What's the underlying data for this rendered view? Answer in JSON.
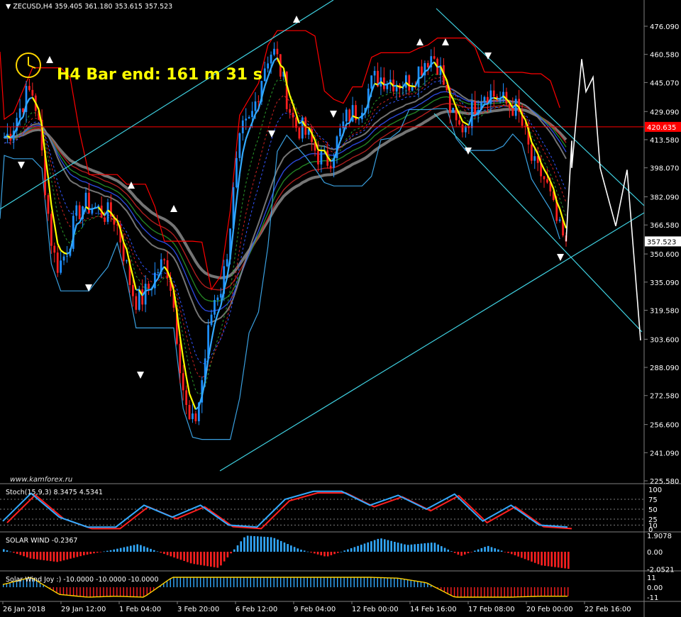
{
  "header": {
    "symbol": "ZECUSD,H4",
    "ohlc": "359.405 361.180 353.615 357.523"
  },
  "overlay": {
    "bar_end": "H4 Bar end: 161 m 31 s",
    "watermark": "www.kamforex.ru"
  },
  "colors": {
    "background": "#000000",
    "bull": "#1e90ff",
    "bear": "#ff2020",
    "channel": "#3fd0e0",
    "signal": "#ffff00",
    "resistance": "#ff0000",
    "support": "#3aa0e0",
    "level_line": "#ff0000",
    "projection": "#ffffff"
  },
  "price_axis": {
    "ticks": [
      "476.090",
      "460.580",
      "445.070",
      "429.090",
      "413.580",
      "398.070",
      "382.090",
      "366.580",
      "350.600",
      "335.090",
      "319.580",
      "303.600",
      "288.090",
      "272.580",
      "256.600",
      "241.090",
      "225.580"
    ],
    "level_label": "420.635",
    "current_label": "357.523"
  },
  "time_axis": {
    "labels": [
      "26 Jan 2018",
      "29 Jan 12:00",
      "1 Feb 04:00",
      "3 Feb 20:00",
      "6 Feb 12:00",
      "9 Feb 04:00",
      "12 Feb 00:00",
      "14 Feb 16:00",
      "17 Feb 08:00",
      "20 Feb 00:00",
      "22 Feb 16:00"
    ]
  },
  "panels": {
    "stoch": {
      "title": "Stoch(15,9,3) 8.3475 4.5341",
      "levels": [
        "100",
        "75",
        "50",
        "25",
        "10",
        "0"
      ]
    },
    "solar_wind": {
      "title": "SOLAR WIND -0.2367",
      "levels": [
        "1.9078",
        "0.00",
        "-2.0521"
      ]
    },
    "solar_joy": {
      "title": "Solar Wind Joy :) -10.0000 -10.0000 -10.0000",
      "levels": [
        "11",
        "0.00",
        "-11"
      ]
    }
  },
  "chart_data": {
    "type": "candlestick",
    "title": "ZECUSD,H4",
    "ylim": [
      225.58,
      476.09
    ],
    "level_line": 420.635,
    "last_price": 357.523,
    "anchors": [
      {
        "x": "26 Jan 2018",
        "price": 415
      },
      {
        "x": "27 Jan",
        "price": 440
      },
      {
        "x": "29 Jan 12:00",
        "price": 345
      },
      {
        "x": "31 Jan",
        "price": 378
      },
      {
        "x": "1 Feb 04:00",
        "price": 372
      },
      {
        "x": "2 Feb",
        "price": 325
      },
      {
        "x": "3 Feb 20:00",
        "price": 345
      },
      {
        "x": "5 Feb",
        "price": 256
      },
      {
        "x": "6 Feb 12:00",
        "price": 330
      },
      {
        "x": "8 Feb",
        "price": 420
      },
      {
        "x": "9 Feb 04:00",
        "price": 462
      },
      {
        "x": "10 Feb",
        "price": 420
      },
      {
        "x": "12 Feb 00:00",
        "price": 402
      },
      {
        "x": "13 Feb",
        "price": 428
      },
      {
        "x": "14 Feb 16:00",
        "price": 448
      },
      {
        "x": "16 Feb",
        "price": 445
      },
      {
        "x": "17 Feb 08:00",
        "price": 460
      },
      {
        "x": "18 Feb",
        "price": 420
      },
      {
        "x": "19 Feb",
        "price": 440
      },
      {
        "x": "20 Feb 00:00",
        "price": 432
      },
      {
        "x": "21 Feb",
        "price": 395
      },
      {
        "x": "22 Feb 16:00",
        "price": 357.5
      }
    ],
    "projection": [
      {
        "x": "after 22 Feb 16:00",
        "price": 357.5
      },
      {
        "price": 413
      },
      {
        "price": 398
      },
      {
        "price": 458
      },
      {
        "price": 440
      },
      {
        "price": 448
      },
      {
        "price": 398
      },
      {
        "price": 366
      },
      {
        "price": 397
      },
      {
        "price": 303
      }
    ],
    "stoch_values": [
      20,
      90,
      30,
      5,
      5,
      60,
      30,
      60,
      10,
      5,
      75,
      95,
      95,
      60,
      85,
      50,
      88,
      20,
      60,
      10,
      5
    ],
    "solar_wind_hist": [
      0.3,
      -0.8,
      -1.2,
      -0.4,
      0.2,
      0.9,
      -0.3,
      -1.4,
      -1.9,
      1.9,
      1.7,
      0.3,
      -0.6,
      0.5,
      1.6,
      0.8,
      1.1,
      -0.5,
      0.7,
      -0.4,
      -1.6,
      -2.0
    ],
    "solar_joy_hist": [
      3,
      11,
      -8,
      -11,
      -10,
      -11,
      11,
      11,
      11,
      11,
      11,
      11,
      11,
      11,
      10,
      5,
      -11,
      -11,
      -11,
      -10,
      -10
    ]
  }
}
